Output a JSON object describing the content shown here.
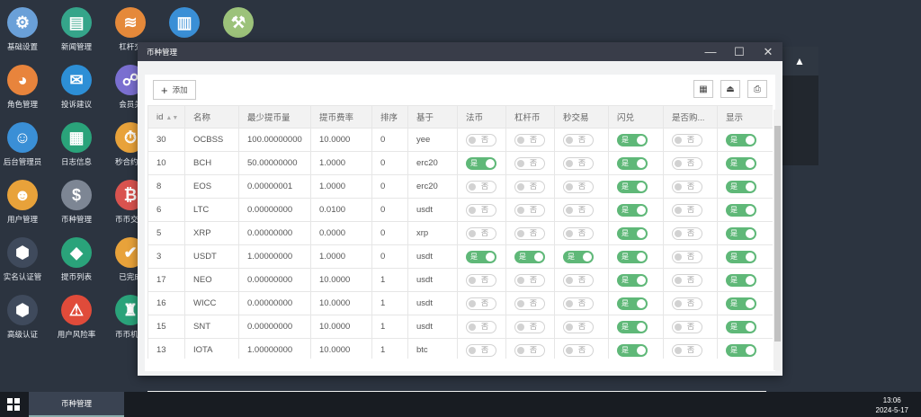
{
  "desktop_icons": [
    {
      "label": "基础设置",
      "icon": "gear-icon",
      "color": "#6aa0d8",
      "glyph": "⚙"
    },
    {
      "label": "新闻管理",
      "icon": "news-doc-icon",
      "color": "#35a58a",
      "glyph": "▤"
    },
    {
      "label": "杠杆交",
      "icon": "layers-icon",
      "color": "#e5893a",
      "glyph": "≋"
    },
    {
      "label": "",
      "icon": "book-icon",
      "color": "#3a8fd6",
      "glyph": "▥"
    },
    {
      "label": "",
      "icon": "hammer-icon",
      "color": "#9cc27a",
      "glyph": "⚒"
    },
    {
      "label": "角色管理",
      "icon": "role-icon",
      "color": "#e8843c",
      "glyph": "◕"
    },
    {
      "label": "投诉建议",
      "icon": "mail-icon",
      "color": "#2d8fd6",
      "glyph": "✉"
    },
    {
      "label": "会员关",
      "icon": "members-icon",
      "color": "#7a6fd0",
      "glyph": "☍"
    },
    {
      "label": "后台管理员",
      "icon": "admin-icon",
      "color": "#3a8fd6",
      "glyph": "☺"
    },
    {
      "label": "日志信息",
      "icon": "log-icon",
      "color": "#2aa37a",
      "glyph": "▦"
    },
    {
      "label": "秒合约交",
      "icon": "timer-icon",
      "color": "#e8a23a",
      "glyph": "⏱"
    },
    {
      "label": "用户管理",
      "icon": "user-search-icon",
      "color": "#e8a23a",
      "glyph": "☻"
    },
    {
      "label": "币种管理",
      "icon": "coin-dollar-icon",
      "color": "#7d8694",
      "glyph": "$"
    },
    {
      "label": "币币交易",
      "icon": "bitcoin-icon",
      "color": "#d9534f",
      "glyph": "₿"
    },
    {
      "label": "实名认证管",
      "icon": "verify-icon",
      "color": "#3f4a5c",
      "glyph": "⬢"
    },
    {
      "label": "提币列表",
      "icon": "withdraw-icon",
      "color": "#2aa37a",
      "glyph": "◆"
    },
    {
      "label": "已完成",
      "icon": "done-icon",
      "color": "#e8a23a",
      "glyph": "✔"
    },
    {
      "label": "高级认证",
      "icon": "advanced-verify-icon",
      "color": "#3f4a5c",
      "glyph": "⬢"
    },
    {
      "label": "用户风险率",
      "icon": "alarm-icon",
      "color": "#e04b3a",
      "glyph": "⚠"
    },
    {
      "label": "币币机器",
      "icon": "robot-icon",
      "color": "#2aa37a",
      "glyph": "♜"
    }
  ],
  "bg_window": {
    "collapse_icon": "▲"
  },
  "window": {
    "title": "币种管理",
    "minimize": "—",
    "maximize": "☐",
    "close": "✕"
  },
  "toolbar": {
    "add_label": "添加",
    "add_icon": "+",
    "tools": [
      {
        "name": "columns-filter-icon",
        "glyph": "▦"
      },
      {
        "name": "export-icon",
        "glyph": "⏏"
      },
      {
        "name": "print-icon",
        "glyph": "⎙"
      }
    ]
  },
  "table": {
    "headers": [
      "id",
      "名称",
      "最少提币量",
      "提币费率",
      "排序",
      "基于",
      "法币",
      "杠杆币",
      "秒交易",
      "闪兑",
      "是否购...",
      "显示"
    ],
    "sort_icon": "▲▼",
    "on_label": "是",
    "off_label": "否",
    "rows": [
      {
        "id": "30",
        "name": "OCBSS",
        "min": "100.00000000",
        "fee": "10.0000",
        "sort": "0",
        "base": "yee",
        "fiat": false,
        "lever": false,
        "second": false,
        "flash": true,
        "buy": false,
        "show": true
      },
      {
        "id": "10",
        "name": "BCH",
        "min": "50.00000000",
        "fee": "1.0000",
        "sort": "0",
        "base": "erc20",
        "fiat": true,
        "lever": false,
        "second": false,
        "flash": true,
        "buy": false,
        "show": true
      },
      {
        "id": "8",
        "name": "EOS",
        "min": "0.00000001",
        "fee": "1.0000",
        "sort": "0",
        "base": "erc20",
        "fiat": false,
        "lever": false,
        "second": false,
        "flash": true,
        "buy": false,
        "show": true
      },
      {
        "id": "6",
        "name": "LTC",
        "min": "0.00000000",
        "fee": "0.0100",
        "sort": "0",
        "base": "usdt",
        "fiat": false,
        "lever": false,
        "second": false,
        "flash": true,
        "buy": false,
        "show": true
      },
      {
        "id": "5",
        "name": "XRP",
        "min": "0.00000000",
        "fee": "0.0000",
        "sort": "0",
        "base": "xrp",
        "fiat": false,
        "lever": false,
        "second": false,
        "flash": true,
        "buy": false,
        "show": true
      },
      {
        "id": "3",
        "name": "USDT",
        "min": "1.00000000",
        "fee": "1.0000",
        "sort": "0",
        "base": "usdt",
        "fiat": true,
        "lever": true,
        "second": true,
        "flash": true,
        "buy": false,
        "show": true
      },
      {
        "id": "17",
        "name": "NEO",
        "min": "0.00000000",
        "fee": "10.0000",
        "sort": "1",
        "base": "usdt",
        "fiat": false,
        "lever": false,
        "second": false,
        "flash": true,
        "buy": false,
        "show": true
      },
      {
        "id": "16",
        "name": "WICC",
        "min": "0.00000000",
        "fee": "10.0000",
        "sort": "1",
        "base": "usdt",
        "fiat": false,
        "lever": false,
        "second": false,
        "flash": true,
        "buy": false,
        "show": true
      },
      {
        "id": "15",
        "name": "SNT",
        "min": "0.00000000",
        "fee": "10.0000",
        "sort": "1",
        "base": "usdt",
        "fiat": false,
        "lever": false,
        "second": false,
        "flash": true,
        "buy": false,
        "show": true
      },
      {
        "id": "13",
        "name": "IOTA",
        "min": "1.00000000",
        "fee": "10.0000",
        "sort": "1",
        "base": "btc",
        "fiat": false,
        "lever": false,
        "second": false,
        "flash": true,
        "buy": false,
        "show": true
      }
    ]
  },
  "taskbar": {
    "task_label": "币种管理",
    "time": "13:06",
    "date": "2024-5-17"
  }
}
